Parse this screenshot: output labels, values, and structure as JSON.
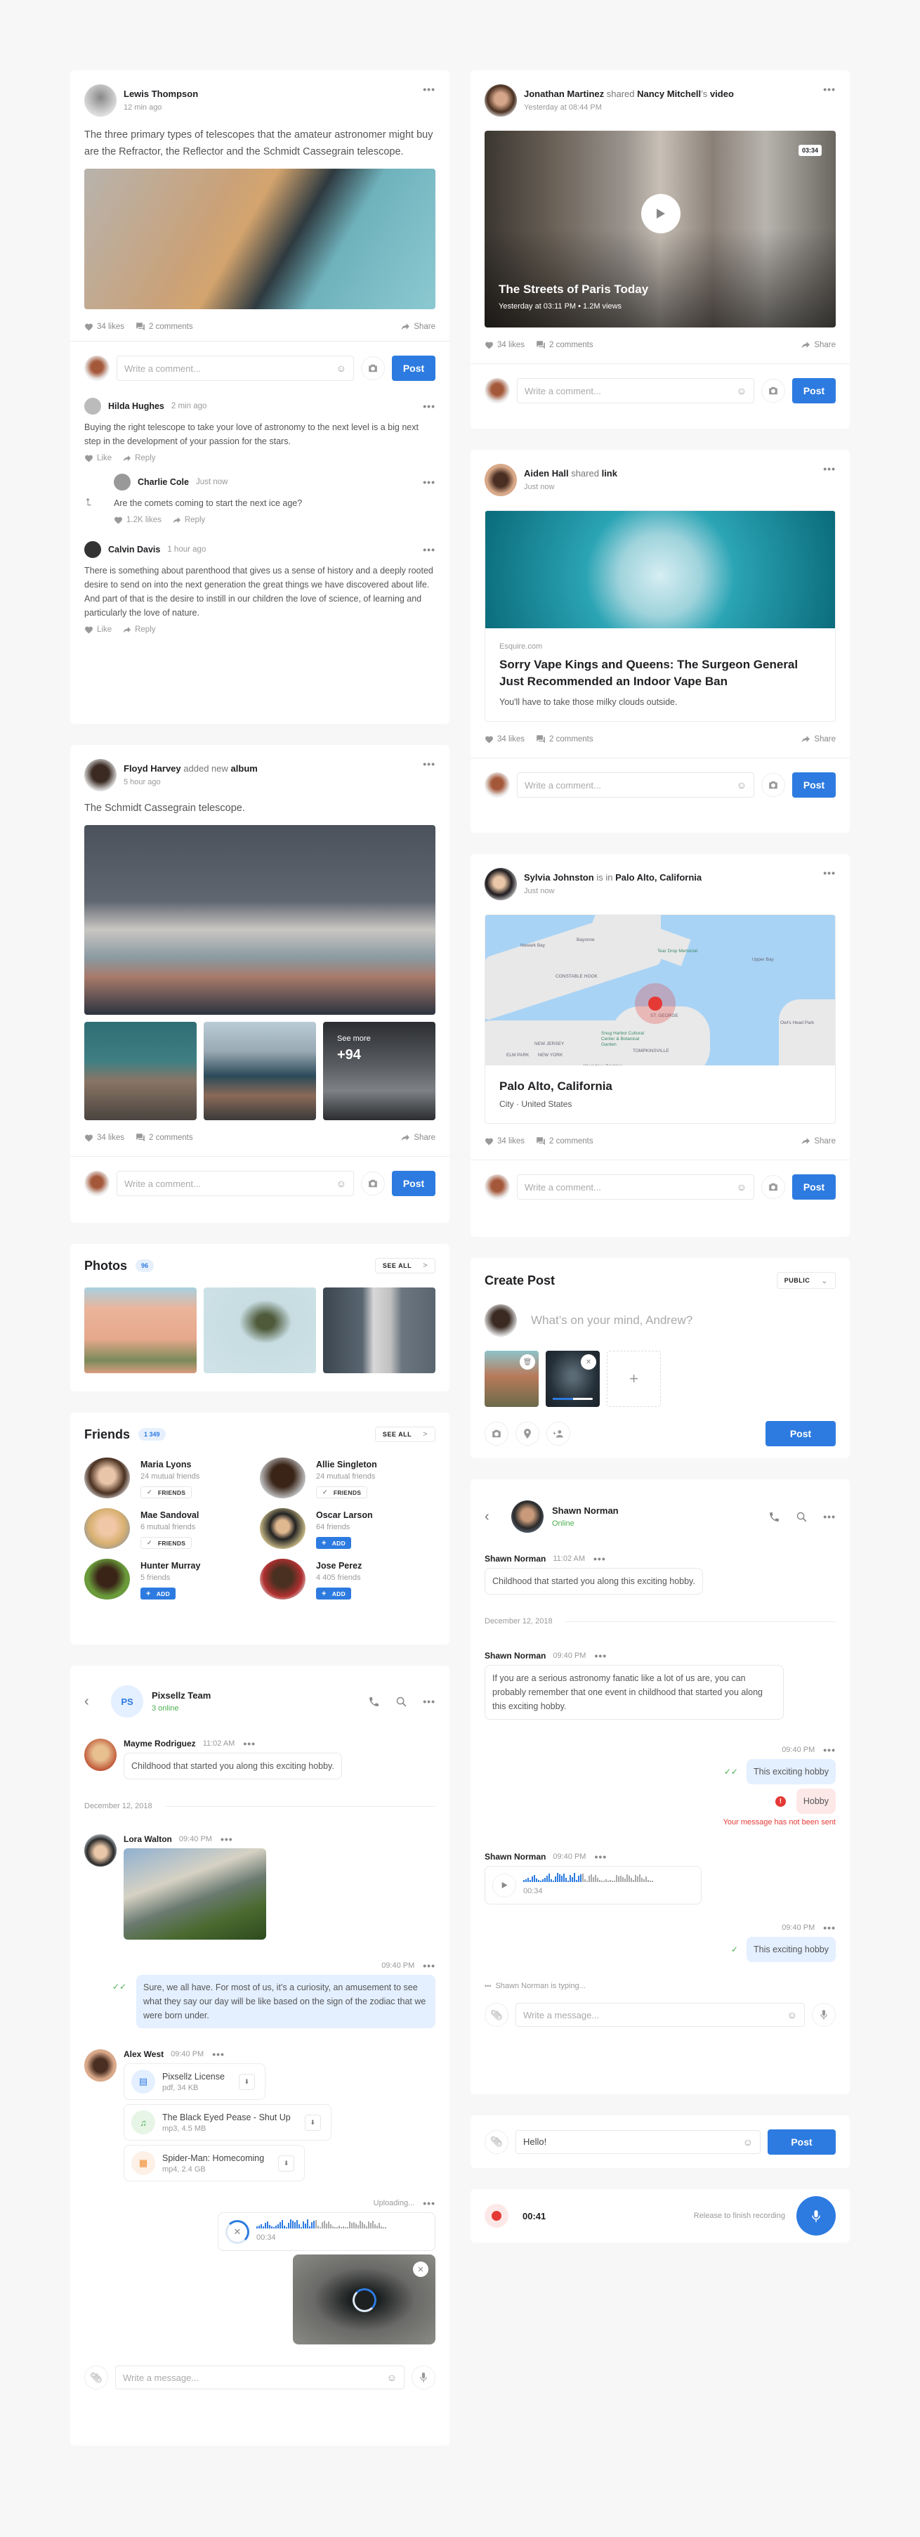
{
  "colors": {
    "accent": "#2d7be0",
    "online": "#4caf50",
    "error": "#e53935",
    "bg": "#f7f7f7"
  },
  "me": {
    "comment_placeholder": "Write a comment...",
    "post_label": "Post"
  },
  "post1": {
    "author": "Lewis Thompson",
    "time": "12 min ago",
    "text": "The three primary types of telescopes that the amateur astronomer might buy are the Refractor, the Reflector and the Schmidt Cassegrain telescope.",
    "likes": "34 likes",
    "comments": "2 comments",
    "share": "Share",
    "comment_list": [
      {
        "name": "Hilda Hughes",
        "time": "2 min ago",
        "text": "Buying the right telescope to take your love of astronomy to the next level is a big next step in the development of your passion for the stars.",
        "like": "Like",
        "reply": "Reply"
      },
      {
        "name": "Charlie Cole",
        "time": "Just now",
        "text": "Are the comets coming to start the next ice age?",
        "like": "1.2K likes",
        "reply": "Reply"
      },
      {
        "name": "Calvin Davis",
        "time": "1 hour ago",
        "text": "There is something about parenthood that gives us a sense of history and a deeply rooted desire to send on into the next generation the great things we have discovered about life. And part of that is the desire to instill in our children the love of science, of learning and particularly the love of nature.",
        "like": "Like",
        "reply": "Reply"
      }
    ]
  },
  "post2": {
    "author": "Floyd Harvey",
    "action": "added new",
    "object": "album",
    "time": "5 hour ago",
    "text": "The Schmidt Cassegrain telescope.",
    "see_more": "See more",
    "more_count": "+94",
    "likes": "34 likes",
    "comments": "2 comments",
    "share": "Share"
  },
  "photos": {
    "title": "Photos",
    "count": "96",
    "see_all": "SEE ALL"
  },
  "friends": {
    "title": "Friends",
    "count": "1 349",
    "see_all": "SEE ALL",
    "list": [
      {
        "name": "Maria Lyons",
        "sub": "24 mutual friends",
        "btn": "FRIENDS",
        "type": "friends"
      },
      {
        "name": "Allie Singleton",
        "sub": "24 mutual friends",
        "btn": "FRIENDS",
        "type": "friends"
      },
      {
        "name": "Mae Sandoval",
        "sub": "6 mutual friends",
        "btn": "FRIENDS",
        "type": "friends"
      },
      {
        "name": "Oscar Larson",
        "sub": "64 friends",
        "btn": "ADD",
        "type": "add"
      },
      {
        "name": "Hunter Murray",
        "sub": "5 friends",
        "btn": "ADD",
        "type": "add"
      },
      {
        "name": "Jose Perez",
        "sub": "4 405 friends",
        "btn": "ADD",
        "type": "add"
      }
    ]
  },
  "group_chat": {
    "initials": "PS",
    "name": "Pixsellz Team",
    "status": "3 online",
    "m1": {
      "name": "Mayme Rodriguez",
      "time": "11:02 AM",
      "text": "Childhood that started you along this exciting hobby."
    },
    "date": "December 12, 2018",
    "m2": {
      "name": "Lora Walton",
      "time": "09:40 PM"
    },
    "m3": {
      "time": "09:40 PM",
      "text": "Sure, we all have. For most of us, it’s a curiosity, an amusement to see what they say our day will be like based on the sign of the zodiac that we were born under."
    },
    "m4": {
      "name": "Alex West",
      "time": "09:40 PM",
      "files": [
        {
          "name": "Pixsellz License",
          "meta": "pdf, 34 KB",
          "kind": "document"
        },
        {
          "name": "The Black Eyed Pease - Shut Up",
          "meta": "mp3, 4.5 MB",
          "kind": "audio"
        },
        {
          "name": "Spider-Man: Homecoming",
          "meta": "mp4, 2.4 GB",
          "kind": "video"
        }
      ]
    },
    "upload": {
      "status": "Uploading...",
      "duration": "00:34"
    },
    "placeholder": "Write a message..."
  },
  "post3": {
    "author": "Jonathan Martinez",
    "action": "shared",
    "owner": "Nancy Mitchell",
    "owner_suffix": "’s",
    "object": "video",
    "time": "Yesterday at 08:44 PM",
    "video_title": "The Streets of Paris Today",
    "video_meta": "Yesterday at 03:11 PM • 1.2M views",
    "duration": "03:34",
    "likes": "34 likes",
    "comments": "2 comments",
    "share": "Share"
  },
  "post4": {
    "author": "Aiden Hall",
    "action": "shared",
    "object": "link",
    "time": "Just now",
    "source": "Esquire.com",
    "title": "Sorry Vape Kings and Queens: The Surgeon General Just Recommended an Indoor Vape Ban",
    "desc": "You'll have to take those milky clouds outside.",
    "likes": "34 likes",
    "comments": "2 comments",
    "share": "Share"
  },
  "post5": {
    "author": "Sylvia Johnston",
    "action": "is in",
    "place": "Palo Alto, California",
    "time": "Just now",
    "place_title": "Palo Alto, California",
    "place_sub": "City · United States",
    "likes": "34 likes",
    "comments": "2 comments",
    "share": "Share",
    "map_labels": [
      "Bayonne",
      "Tear Drop Memorial",
      "CONSTABLE HOOK",
      "NEW JERSEY",
      "NEW YORK",
      "Snug Harbor Cultural Center & Botanical Garden",
      "ST. GEORGE",
      "West New Brighton",
      "TOMPKINSVILLE",
      "ELM PARK",
      "Upper Bay",
      "Owl's Head Park",
      "Newark Bay"
    ]
  },
  "create_post": {
    "title": "Create Post",
    "visibility": "PUBLIC",
    "placeholder": "What’s on your mind, Andrew?",
    "upload_progress": 0.5,
    "post_label": "Post"
  },
  "dm": {
    "name": "Shawn Norman",
    "status": "Online",
    "m1": {
      "name": "Shawn Norman",
      "time": "11:02 AM",
      "text": "Childhood that started you along this exciting hobby."
    },
    "date": "December 12, 2018",
    "m2": {
      "name": "Shawn Norman",
      "time": "09:40 PM",
      "text": "If you are a serious astronomy fanatic like a lot of us are, you can probably remember that one event in childhood that started you along this exciting hobby."
    },
    "m3": {
      "time": "09:40 PM",
      "text": "This exciting hobby",
      "failed": "Hobby",
      "error": "Your message has not been sent"
    },
    "m4": {
      "name": "Shawn Norman",
      "time": "09:40 PM",
      "duration": "00:34"
    },
    "m5": {
      "time": "09:40 PM",
      "text": "This exciting hobby"
    },
    "typing": "Shawn Norman is typing...",
    "placeholder": "Write a message..."
  },
  "quick_reply": {
    "value": "Hello!",
    "post_label": "Post"
  },
  "recorder": {
    "time": "00:41",
    "hint": "Release to finish recording"
  }
}
